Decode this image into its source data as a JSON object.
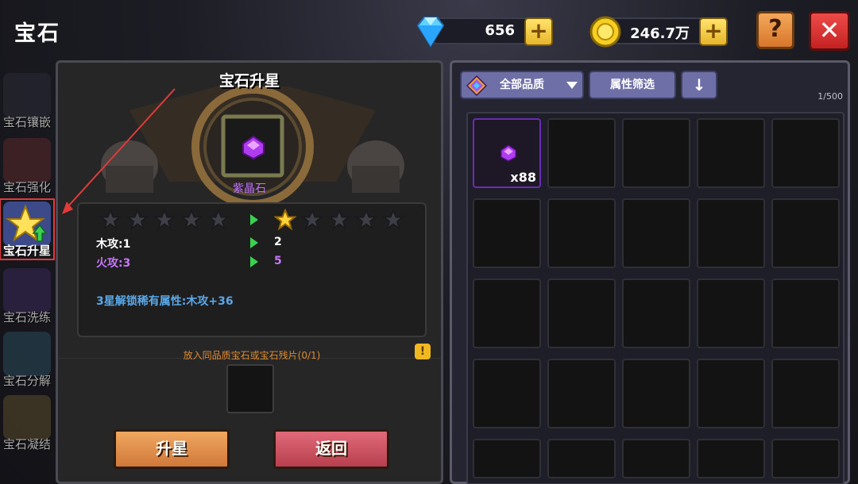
{
  "header": {
    "title": "宝石"
  },
  "currency": {
    "diamonds": {
      "value": "656",
      "icon": "diamond-icon"
    },
    "gold": {
      "value": "246.7万",
      "icon": "gold-coin-icon"
    },
    "plus_label": "+"
  },
  "top_buttons": {
    "help_label": "?",
    "close_label": "✕"
  },
  "sidebar": {
    "tabs": [
      {
        "label": "宝石镶嵌",
        "icon": "gem-inlay-icon"
      },
      {
        "label": "宝石强化",
        "icon": "gem-enhance-icon"
      },
      {
        "label": "宝石升星",
        "icon": "gem-star-up-icon",
        "active": true
      },
      {
        "label": "宝石洗练",
        "icon": "gem-refine-icon"
      },
      {
        "label": "宝石分解",
        "icon": "gem-decompose-icon"
      },
      {
        "label": "宝石凝结",
        "icon": "gem-condense-icon"
      }
    ]
  },
  "upgrade_panel": {
    "title": "宝石升星",
    "gem_name": "紫晶石",
    "current_stars": 0,
    "next_stars": 1,
    "max_stars": 5,
    "stats": [
      {
        "label": "木攻:1",
        "next": "2",
        "color": "#ffffff"
      },
      {
        "label": "火攻:3",
        "next": "5",
        "color": "#c874ff"
      }
    ],
    "rare_unlock": {
      "text": "3星解锁稀有属性:",
      "value": "木攻+36"
    },
    "hint": "放入同品质宝石或宝石残片(0/1)",
    "warn_label": "!",
    "upgrade_button": "升星",
    "back_button": "返回"
  },
  "inventory": {
    "quality_filter": "全部品质",
    "attribute_filter": "属性筛选",
    "sort_label": "↓",
    "capacity": "1/500",
    "items": [
      {
        "name": "紫晶石",
        "quantity": "x88"
      }
    ]
  },
  "colors": {
    "accent_purple": "#c074ff",
    "rare_blue": "#5aa8e8",
    "hint_orange": "#e08a30",
    "highlight_red": "#e03a3a"
  }
}
